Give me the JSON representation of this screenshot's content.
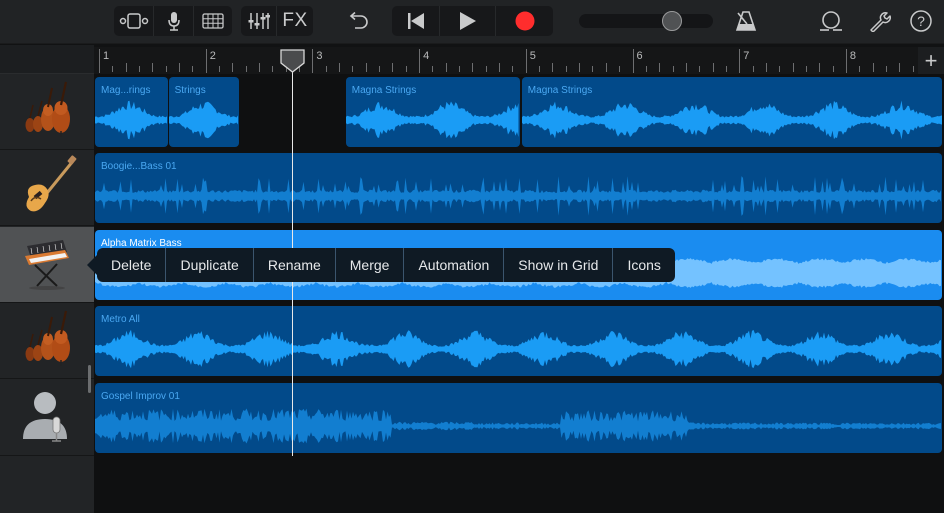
{
  "toolbar": {
    "view_group": [
      {
        "name": "tracks-view-icon"
      },
      {
        "name": "microphone-icon"
      },
      {
        "name": "grid-icon"
      }
    ],
    "mix_group": [
      {
        "name": "mixer-icon"
      },
      {
        "name": "fx-icon",
        "label": "FX"
      }
    ],
    "undo": {
      "name": "undo-icon"
    },
    "transport": [
      {
        "name": "go-to-start-icon"
      },
      {
        "name": "play-icon"
      },
      {
        "name": "record-icon"
      }
    ],
    "master_volume": 0.73,
    "right": [
      {
        "name": "metronome-icon"
      },
      {
        "name": "loop-icon"
      },
      {
        "name": "settings-wrench-icon"
      },
      {
        "name": "help-icon"
      }
    ],
    "colors": {
      "record": "#ff2d2d",
      "icon": "#c9cacb"
    }
  },
  "ruler": {
    "bars": [
      "1",
      "2",
      "3",
      "4",
      "5",
      "6",
      "7",
      "8"
    ],
    "add_label": "+"
  },
  "playhead_bar": 2.85,
  "tracks": [
    {
      "instrument": "strings",
      "name": "strings-track",
      "regions": [
        {
          "label": "Mag...rings",
          "start": 1.0,
          "end": 1.68
        },
        {
          "label": "Strings",
          "start": 1.69,
          "end": 2.35
        },
        {
          "label": "Magna Strings",
          "start": 3.35,
          "end": 4.98
        },
        {
          "label": "Magna Strings",
          "start": 5.0,
          "end": 8.99
        }
      ]
    },
    {
      "instrument": "bass-guitar",
      "name": "bass-track",
      "regions": [
        {
          "label": "Boogie...Bass 01",
          "start": 1.0,
          "end": 8.99
        }
      ]
    },
    {
      "instrument": "synth-keyboard",
      "name": "synth-bass-track",
      "selected": true,
      "regions": [
        {
          "label": "Alpha Matrix Bass",
          "start": 1.0,
          "end": 8.99,
          "selected": true
        }
      ]
    },
    {
      "instrument": "strings",
      "name": "metro-track",
      "regions": [
        {
          "label": "Metro All",
          "start": 1.0,
          "end": 8.99
        }
      ]
    },
    {
      "instrument": "vocal-mic",
      "name": "vocal-track",
      "regions": [
        {
          "label": "Gospel Improv 01",
          "start": 1.0,
          "end": 8.99
        }
      ]
    }
  ],
  "context_menu": {
    "items": [
      "Delete",
      "Duplicate",
      "Rename",
      "Merge",
      "Automation",
      "Show in Grid",
      "Icons"
    ]
  },
  "colors": {
    "region": "#024a8a",
    "region_selected": "#1a8cf0",
    "waveform": "#1a9cf5",
    "waveform_dim": "#127ed0",
    "waveform_selected": "#74c2ff"
  }
}
